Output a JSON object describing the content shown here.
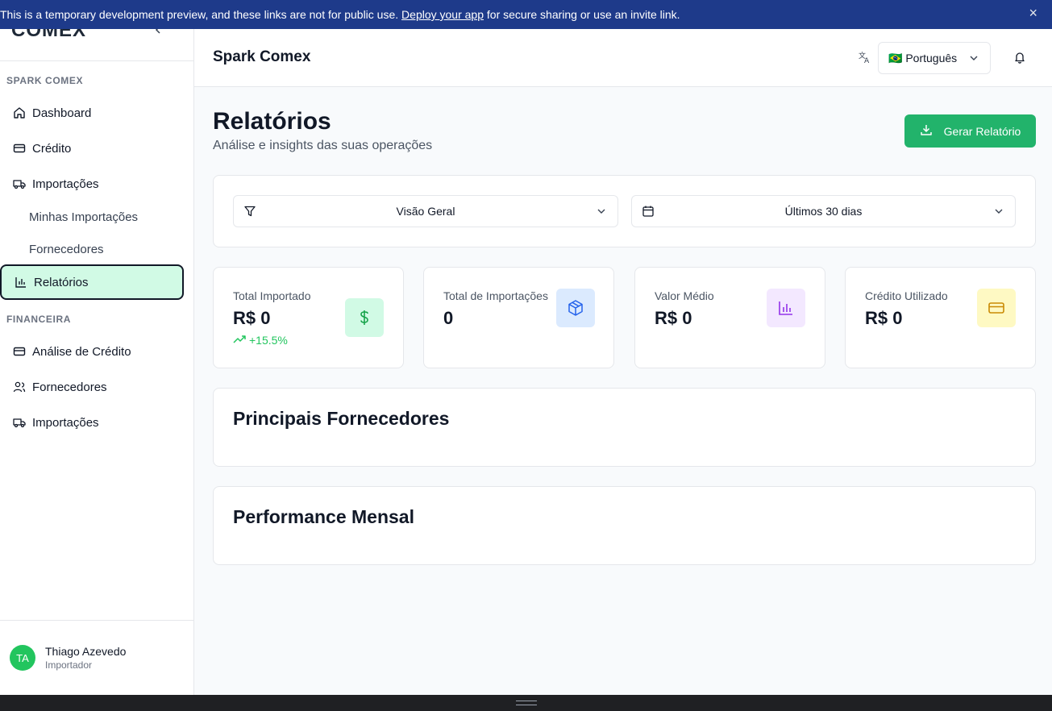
{
  "banner": {
    "text_before": "This is a temporary development preview, and these links are not for public use. ",
    "link": "Deploy your app",
    "text_after": " for secure sharing or use an invite link.",
    "close": "×"
  },
  "sidebar": {
    "logo": "COMEX",
    "section1": "SPARK COMEX",
    "items": [
      {
        "label": "Dashboard",
        "icon": "home-icon"
      },
      {
        "label": "Crédito",
        "icon": "credit-card-icon"
      },
      {
        "label": "Importações",
        "icon": "truck-icon"
      }
    ],
    "sub_items": [
      "Minhas Importações",
      "Fornecedores"
    ],
    "active_item": {
      "label": "Relatórios",
      "icon": "bar-chart-icon"
    },
    "section2": "FINANCEIRA",
    "items2": [
      {
        "label": "Análise de Crédito",
        "icon": "credit-card-icon"
      },
      {
        "label": "Fornecedores",
        "icon": "users-icon"
      },
      {
        "label": "Importações",
        "icon": "truck-icon"
      }
    ],
    "user": {
      "initials": "TA",
      "name": "Thiago Azevedo",
      "role": "Importador"
    }
  },
  "header": {
    "title": "Spark Comex",
    "language": "🇧🇷 Português"
  },
  "main": {
    "title": "Relatórios",
    "subtitle": "Análise e insights das suas operações",
    "generate_button": "Gerar Relatório",
    "filters": {
      "view": "Visão Geral",
      "period": "Últimos 30 dias"
    },
    "cards": [
      {
        "label": "Total Importado",
        "value": "R$ 0",
        "trend": "+15.5%",
        "icon": "dollar-icon",
        "color": "#d1fae5",
        "fg": "#16a34a"
      },
      {
        "label": "Total de Importações",
        "value": "0",
        "icon": "package-icon",
        "color": "#dbeafe",
        "fg": "#2563eb"
      },
      {
        "label": "Valor Médio",
        "value": "R$ 0",
        "icon": "bar-chart-icon",
        "color": "#f3e8ff",
        "fg": "#9333ea"
      },
      {
        "label": "Crédito Utilizado",
        "value": "R$ 0",
        "icon": "credit-card-icon",
        "color": "#fef9c3",
        "fg": "#ca8a04"
      }
    ],
    "sections": [
      "Principais Fornecedores",
      "Performance Mensal"
    ]
  }
}
